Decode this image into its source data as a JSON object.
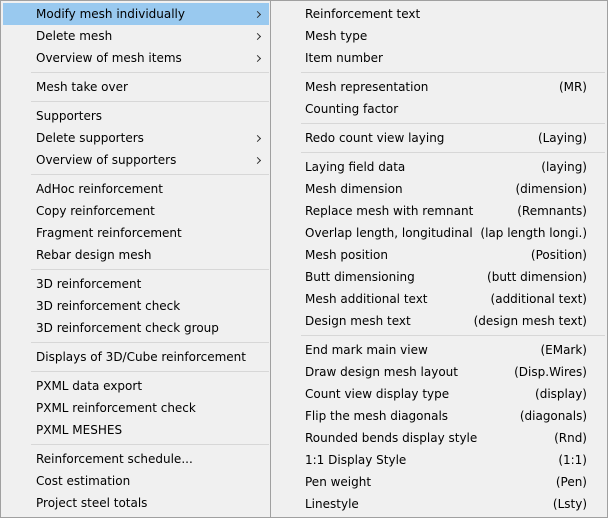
{
  "main_menu": {
    "groups": [
      [
        {
          "label": "Modify mesh individually",
          "submenu": true,
          "highlighted": true
        },
        {
          "label": "Delete mesh",
          "submenu": true
        },
        {
          "label": "Overview of mesh items",
          "submenu": true
        }
      ],
      [
        {
          "label": "Mesh take over"
        }
      ],
      [
        {
          "label": "Supporters"
        },
        {
          "label": "Delete supporters",
          "submenu": true
        },
        {
          "label": "Overview of supporters",
          "submenu": true
        }
      ],
      [
        {
          "label": "AdHoc reinforcement"
        },
        {
          "label": "Copy reinforcement"
        },
        {
          "label": "Fragment reinforcement"
        },
        {
          "label": "Rebar design mesh"
        }
      ],
      [
        {
          "label": "3D reinforcement"
        },
        {
          "label": "3D reinforcement check"
        },
        {
          "label": "3D reinforcement check group"
        }
      ],
      [
        {
          "label": "Displays of 3D/Cube reinforcement"
        }
      ],
      [
        {
          "label": "PXML data export"
        },
        {
          "label": "PXML reinforcement check"
        },
        {
          "label": "PXML MESHES"
        }
      ],
      [
        {
          "label": "Reinforcement schedule..."
        },
        {
          "label": "Cost estimation"
        },
        {
          "label": "Project steel totals"
        }
      ]
    ]
  },
  "sub_menu": {
    "groups": [
      [
        {
          "label": "Reinforcement text",
          "shortcut": ""
        },
        {
          "label": "Mesh type",
          "shortcut": ""
        },
        {
          "label": "Item number",
          "shortcut": ""
        }
      ],
      [
        {
          "label": "Mesh representation",
          "shortcut": "(MR)"
        },
        {
          "label": "Counting factor",
          "shortcut": ""
        }
      ],
      [
        {
          "label": "Redo count view laying",
          "shortcut": "(Laying)"
        }
      ],
      [
        {
          "label": "Laying field data",
          "shortcut": "(laying)"
        },
        {
          "label": "Mesh dimension",
          "shortcut": "(dimension)"
        },
        {
          "label": "Replace mesh with remnant",
          "shortcut": "(Remnants)"
        },
        {
          "label": "Overlap length, longitudinal",
          "shortcut": "(lap length longi.)"
        },
        {
          "label": "Mesh position",
          "shortcut": "(Position)"
        },
        {
          "label": "Butt dimensioning",
          "shortcut": "(butt dimension)"
        },
        {
          "label": "Mesh additional text",
          "shortcut": "(additional text)"
        },
        {
          "label": "Design mesh text",
          "shortcut": "(design mesh text)"
        }
      ],
      [
        {
          "label": "End mark main view",
          "shortcut": "(EMark)"
        },
        {
          "label": "Draw design mesh layout",
          "shortcut": "(Disp.Wires)"
        },
        {
          "label": "Count view display type",
          "shortcut": "(display)"
        },
        {
          "label": "Flip the mesh diagonals",
          "shortcut": "(diagonals)"
        },
        {
          "label": "Rounded bends display style",
          "shortcut": "(Rnd)"
        },
        {
          "label": "1:1 Display Style",
          "shortcut": "(1:1)"
        },
        {
          "label": "Pen weight",
          "shortcut": "(Pen)"
        },
        {
          "label": "Linestyle",
          "shortcut": "(Lsty)"
        }
      ]
    ]
  }
}
